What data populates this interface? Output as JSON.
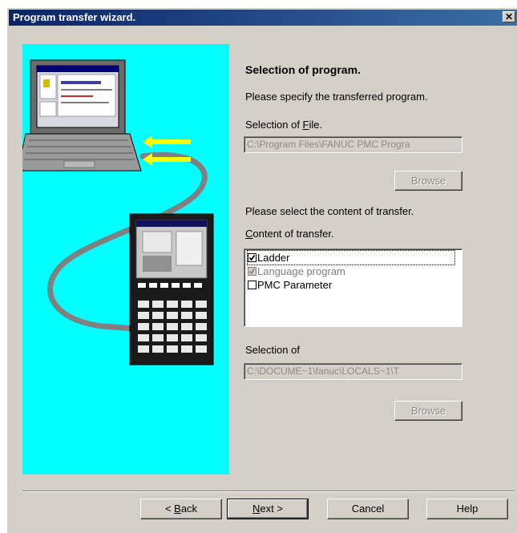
{
  "window": {
    "title": "Program transfer wizard."
  },
  "heading": "Selection of program.",
  "instruction": "Please specify the transferred program.",
  "file_section": {
    "label_prefix": "Selection of ",
    "label_accel": "F",
    "label_suffix": "ile.",
    "path": "C:\\Program Files\\FANUC PMC Progra",
    "browse_label": "Browse"
  },
  "content_section": {
    "instruction": "Please select the content of transfer.",
    "label_accel": "C",
    "label_suffix": "ontent of transfer.",
    "items": [
      {
        "label": "Ladder",
        "checked": true,
        "enabled": true
      },
      {
        "label": "Language program",
        "checked": true,
        "enabled": false
      },
      {
        "label": "PMC Parameter",
        "checked": false,
        "enabled": true
      }
    ]
  },
  "output_section": {
    "label": "Selection of",
    "path": "C:\\DOCUME~1\\fanuc\\LOCALS~1\\T",
    "browse_label": "Browse"
  },
  "footer": {
    "back_prefix": "< ",
    "back_accel": "B",
    "back_suffix": "ack",
    "next_accel": "N",
    "next_suffix": "ext >",
    "cancel_label": "Cancel",
    "help_label": "Help"
  },
  "colors": {
    "title_bar": "#0a246a",
    "panel_background": "#d4d0c8",
    "illustration_background": "#00ffff"
  }
}
